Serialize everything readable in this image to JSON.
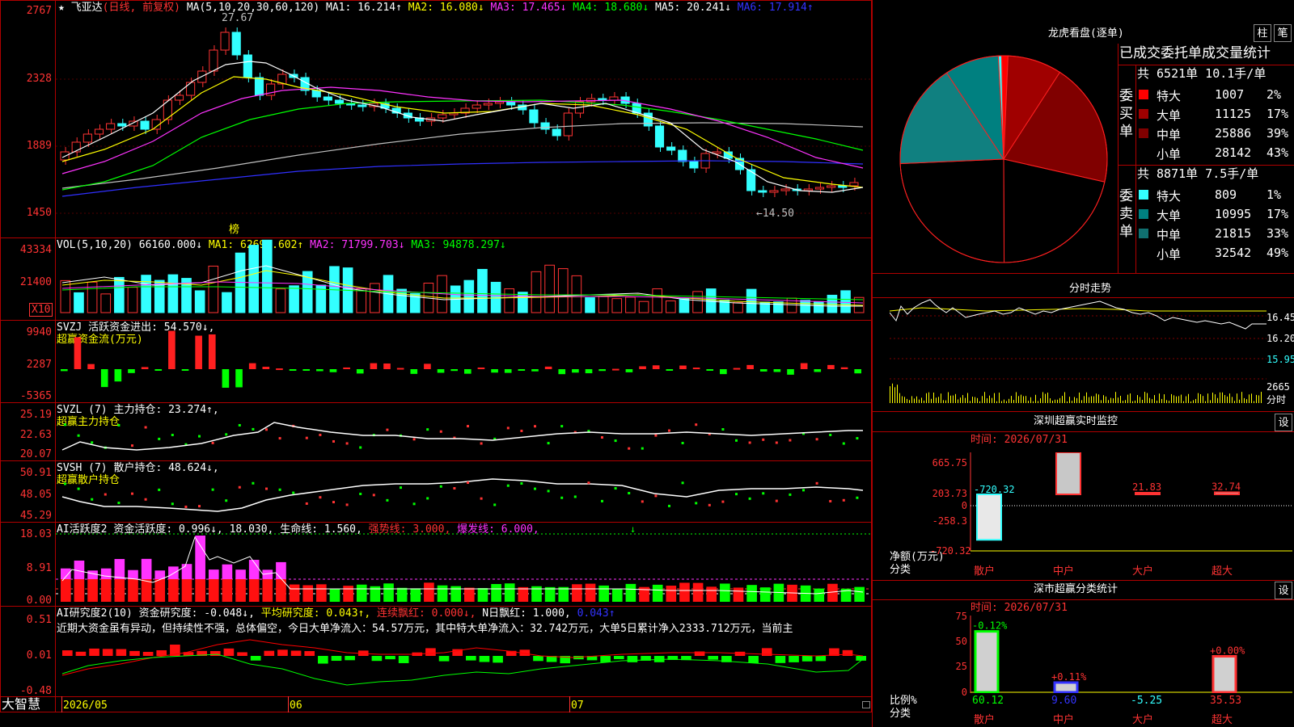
{
  "stock": {
    "star": "★",
    "name": "飞亚达",
    "mode": "(日线, 前复权)",
    "ma_title": "MA(5,10,20,30,60,120)",
    "ma1": "MA1: 16.214↑",
    "ma2": "MA2: 16.080↓",
    "ma3": "MA3: 17.465↓",
    "ma4": "MA4: 18.680↓",
    "ma5": "MA5: 20.241↓",
    "ma6": "MA6: 17.914↑",
    "high_mark": "27.67",
    "low_mark": "←14.50",
    "bang": "榜"
  },
  "price_axis": [
    "2767",
    "2328",
    "1889",
    "1450"
  ],
  "volume": {
    "title": "VOL(5,10,20)",
    "value": "66160.000↓",
    "ma1": "MA1: 62695.602↑",
    "ma2": "MA2: 71799.703↓",
    "ma3": "MA3: 94878.297↓",
    "axis": [
      "43334",
      "21400"
    ],
    "unit": "X10"
  },
  "svzj": {
    "title": "SVZJ  活跃资金进出: 54.570↓,",
    "subtitle": "超赢资金流(万元)",
    "axis": [
      "9940",
      "2287",
      "-5365"
    ]
  },
  "svzl": {
    "title": "SVZL (7) 主力持仓: 23.274↑,",
    "subtitle": "超赢主力持仓",
    "axis": [
      "25.19",
      "22.63",
      "20.07"
    ]
  },
  "svsh": {
    "title": "SVSH (7) 散户持仓: 48.624↓,",
    "subtitle": "超赢散户持仓",
    "axis": [
      "50.91",
      "48.05",
      "45.29"
    ]
  },
  "ai_active": {
    "title": "AI活跃度2",
    "label": "资金活跃度: 0.996↓,",
    "v2": "18.030,",
    "life": "生命线: 1.560,",
    "strong": "强势线: 3.000,",
    "burst": "爆发线: 6.000,",
    "axis": [
      "18.03",
      "8.91",
      "0.00"
    ]
  },
  "ai_research": {
    "title": "AI研究度2(10)",
    "label": "资金研究度: -0.048↓,",
    "avg": "平均研究度: 0.043↑,",
    "red": "连续飘红: 0.000↓,",
    "nday": "N日飘红: 1.000,",
    "last": "0.043↑",
    "comment": "近期大资金虽有异动，但持续性不强，总体偏空，今日大单净流入：54.57万元，其中特大单净流入：32.742万元，大单5日累计净入2333.712万元，当前主",
    "axis": [
      "0.51",
      "0.01",
      "-0.48"
    ]
  },
  "bottom_bar": {
    "brand": "大智慧",
    "dates": [
      "2026/05",
      "06",
      "07"
    ]
  },
  "lhb": {
    "title": "龙虎看盘(逐单)",
    "btn1": "柱",
    "btn2": "笔",
    "subtitle": "已成交委托单成交量统计",
    "buy_label": "委买单",
    "sell_label": "委卖单",
    "buy_header": "共 6521单 10.1手/单",
    "sell_header": "共 8871单 7.5手/单",
    "buy_rows": [
      {
        "name": "特大",
        "vol": "1007",
        "pct": "2%",
        "color": "#ff0000"
      },
      {
        "name": "大单",
        "vol": "11125",
        "pct": "17%",
        "color": "#a00000"
      },
      {
        "name": "中单",
        "vol": "25886",
        "pct": "39%",
        "color": "#800000"
      },
      {
        "name": "小单",
        "vol": "28142",
        "pct": "43%",
        "color": ""
      }
    ],
    "sell_rows": [
      {
        "name": "特大",
        "vol": "809",
        "pct": "1%",
        "color": "#33ffff"
      },
      {
        "name": "大单",
        "vol": "10995",
        "pct": "17%",
        "color": "#008080"
      },
      {
        "name": "中单",
        "vol": "21815",
        "pct": "33%",
        "color": "#107070"
      },
      {
        "name": "小单",
        "vol": "32542",
        "pct": "49%",
        "color": ""
      }
    ]
  },
  "fenshi": {
    "title": "分时走势",
    "axis": [
      "16.45",
      "16.20",
      "15.95"
    ],
    "vol": "2665",
    "vol_label": "分时"
  },
  "sz_monitor": {
    "title": "深圳超赢实时监控",
    "btn": "设",
    "time": "时间: 2026/07/31",
    "axis": [
      "665.75",
      "203.73",
      "0",
      "-258.3",
      "-720.32"
    ],
    "bars": [
      {
        "label": "散户",
        "value": "-720.32"
      },
      {
        "label": "中户",
        "value": "665.75"
      },
      {
        "label": "大户",
        "value": "21.83"
      },
      {
        "label": "超大",
        "value": "32.74"
      }
    ],
    "ylabel": "净额(万元)",
    "xlabel": "分类"
  },
  "sz_class": {
    "title": "深市超赢分类统计",
    "btn": "设",
    "time": "时间: 2026/07/31",
    "axis": [
      "75",
      "50",
      "25",
      "0"
    ],
    "bars": [
      {
        "label": "散户",
        "top": "-0.12%",
        "value": "60.12"
      },
      {
        "label": "中户",
        "top": "+0.11%",
        "value": "9.60"
      },
      {
        "label": "大户",
        "top": "",
        "value": "-5.25"
      },
      {
        "label": "超大",
        "top": "+0.00%",
        "value": "35.53"
      }
    ],
    "ylabel": "比例%",
    "xlabel": "分类"
  }
}
